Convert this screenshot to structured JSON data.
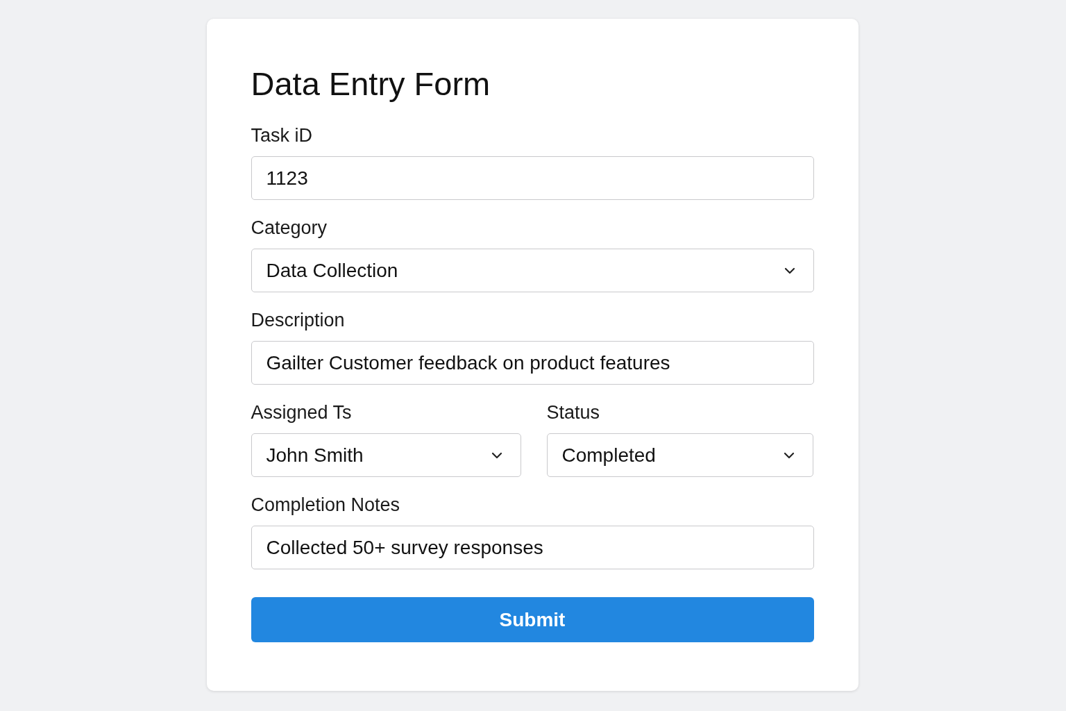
{
  "form": {
    "title": "Data Entry Form",
    "rows": [
      {
        "fields": [
          {
            "kind": "text",
            "label": "Task iD",
            "value": "1123"
          }
        ]
      },
      {
        "fields": [
          {
            "kind": "select",
            "label": "Category",
            "value": "Data Collection"
          }
        ]
      },
      {
        "fields": [
          {
            "kind": "text",
            "label": "Description",
            "value": "Gailter Customer feedback on product features"
          }
        ]
      },
      {
        "fields": [
          {
            "kind": "select",
            "label": "Assigned Ts",
            "value": "John Smith"
          },
          {
            "kind": "select",
            "label": "Status",
            "value": "Completed"
          }
        ]
      },
      {
        "fields": [
          {
            "kind": "text",
            "label": "Completion Notes",
            "value": "Collected 50+ survey responses"
          }
        ]
      }
    ],
    "submit": "Submit"
  }
}
